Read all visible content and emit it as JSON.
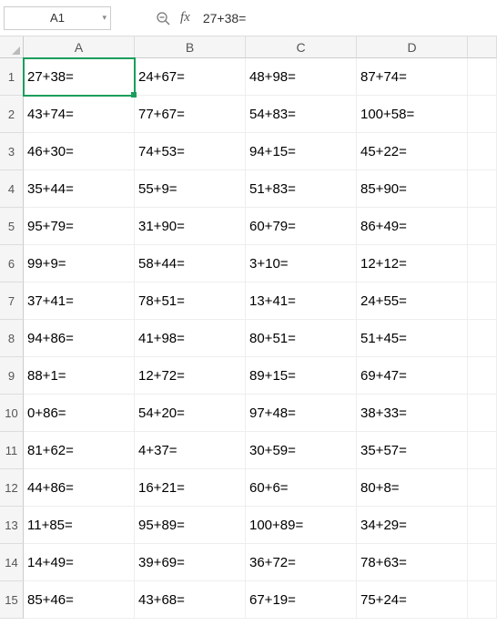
{
  "toolbar": {
    "name_box": "A1",
    "fx_label": "fx",
    "formula_value": "27+38="
  },
  "columns": [
    "A",
    "B",
    "C",
    "D",
    ""
  ],
  "row_numbers": [
    "1",
    "2",
    "3",
    "4",
    "5",
    "6",
    "7",
    "8",
    "9",
    "10",
    "11",
    "12",
    "13",
    "14",
    "15"
  ],
  "grid": [
    [
      "27+38=",
      "24+67=",
      "48+98=",
      "87+74="
    ],
    [
      "43+74=",
      "77+67=",
      "54+83=",
      "100+58="
    ],
    [
      "46+30=",
      "74+53=",
      "94+15=",
      "45+22="
    ],
    [
      "35+44=",
      "55+9=",
      "51+83=",
      "85+90="
    ],
    [
      "95+79=",
      "31+90=",
      "60+79=",
      "86+49="
    ],
    [
      "99+9=",
      "58+44=",
      "3+10=",
      "12+12="
    ],
    [
      "37+41=",
      "78+51=",
      "13+41=",
      "24+55="
    ],
    [
      "94+86=",
      "41+98=",
      "80+51=",
      "51+45="
    ],
    [
      "88+1=",
      "12+72=",
      "89+15=",
      "69+47="
    ],
    [
      "0+86=",
      "54+20=",
      "97+48=",
      "38+33="
    ],
    [
      "81+62=",
      "4+37=",
      "30+59=",
      "35+57="
    ],
    [
      "44+86=",
      "16+21=",
      "60+6=",
      "80+8="
    ],
    [
      "11+85=",
      "95+89=",
      "100+89=",
      "34+29="
    ],
    [
      "14+49=",
      "39+69=",
      "36+72=",
      "78+63="
    ],
    [
      "85+46=",
      "43+68=",
      "67+19=",
      "75+24="
    ]
  ],
  "active_cell": {
    "row": 0,
    "col": 0
  }
}
